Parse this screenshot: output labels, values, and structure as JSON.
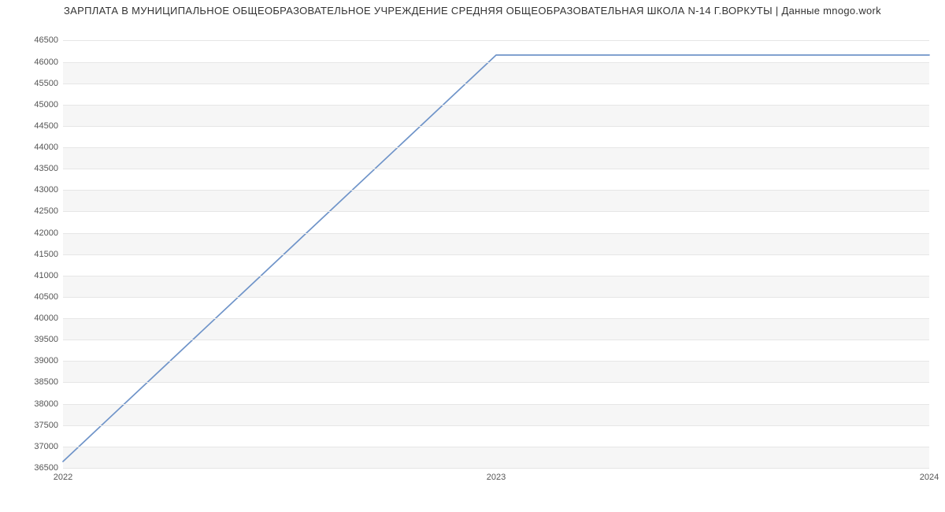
{
  "chart_data": {
    "type": "line",
    "title": "ЗАРПЛАТА В МУНИЦИПАЛЬНОЕ ОБЩЕОБРАЗОВАТЕЛЬНОЕ УЧРЕЖДЕНИЕ СРЕДНЯЯ ОБЩЕОБРАЗОВАТЕЛЬНАЯ ШКОЛА N-14 Г.ВОРКУТЫ | Данные mnogo.work",
    "xlabel": "",
    "ylabel": "",
    "x": [
      2022,
      2023,
      2024
    ],
    "values": [
      36650,
      46160,
      46160
    ],
    "x_ticks": [
      2022,
      2023,
      2024
    ],
    "y_ticks": [
      36500,
      37000,
      37500,
      38000,
      38500,
      39000,
      39500,
      40000,
      40500,
      41000,
      41500,
      42000,
      42500,
      43000,
      43500,
      44000,
      44500,
      45000,
      45500,
      46000,
      46500
    ],
    "xlim": [
      2022,
      2024
    ],
    "ylim": [
      36500,
      46600
    ],
    "line_color": "#6f94c9"
  }
}
